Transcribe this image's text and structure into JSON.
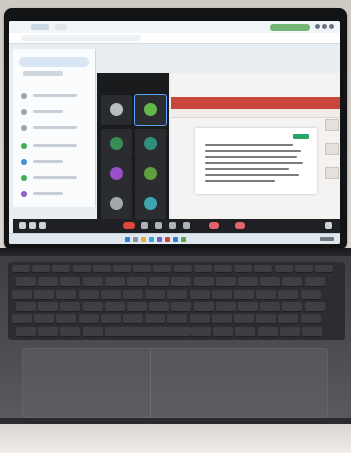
{
  "scene": {
    "subject": "laptop-video-call",
    "colors": {
      "lid": "#121314",
      "deck": "#4c4d52",
      "screen": "#e9eef3",
      "ribbon": "#c8463b",
      "accent_green": "#2aa56a",
      "end_call": "#e0443b"
    }
  },
  "icons": {
    "controls": [
      "mic-icon",
      "camera-icon",
      "share-icon",
      "participants-icon",
      "chat-icon",
      "more-icon",
      "leave-icon"
    ]
  }
}
